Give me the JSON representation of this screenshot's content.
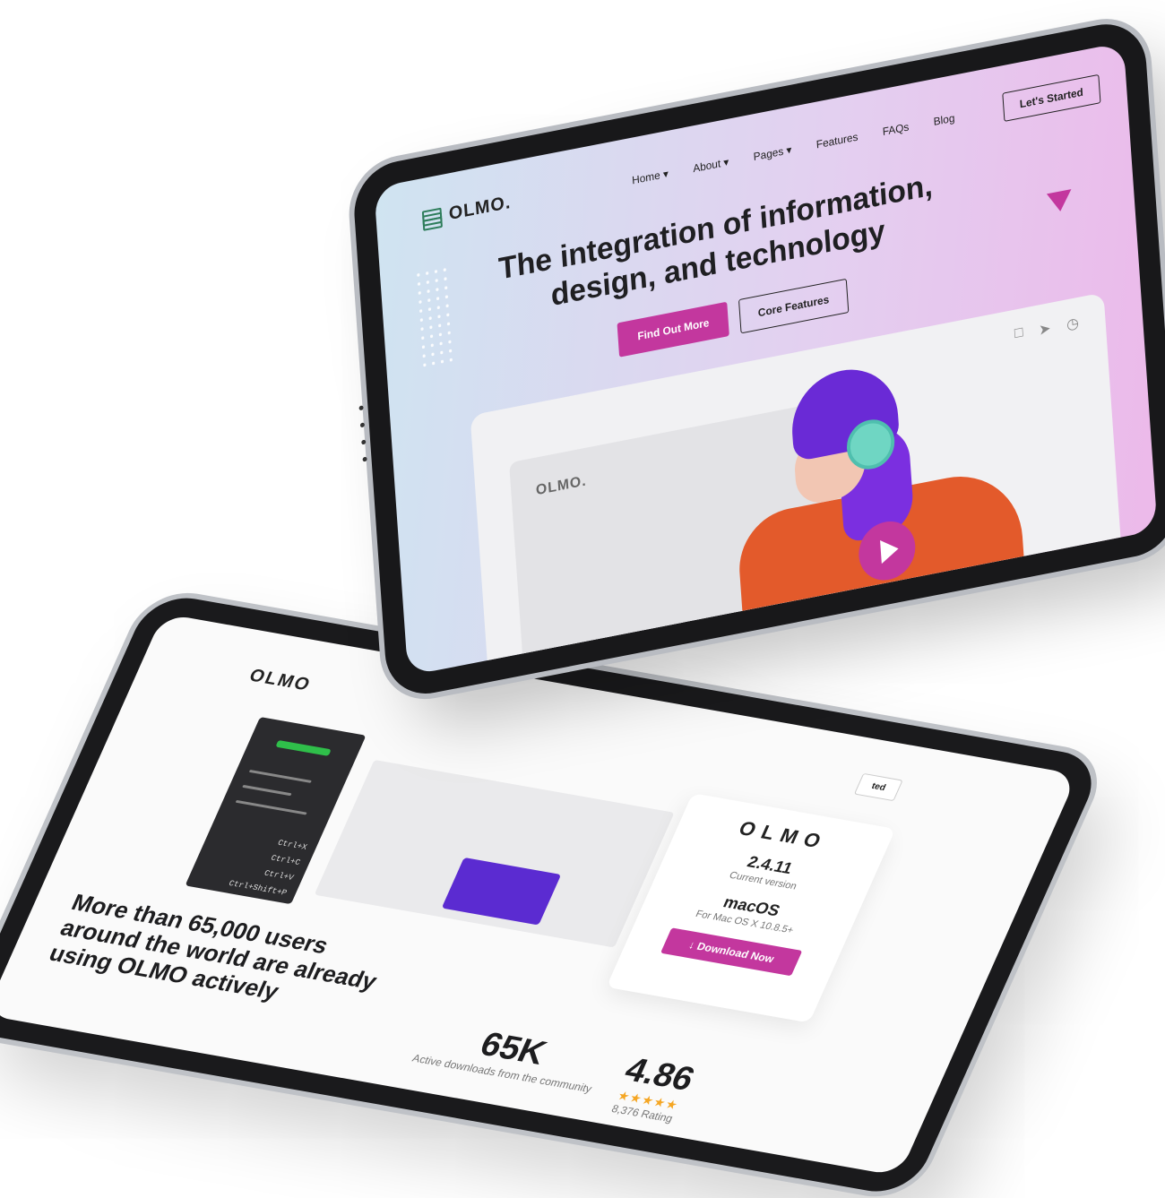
{
  "back_tablet": {
    "logo": "OLMO",
    "shortcuts": [
      "Ctrl+X",
      "Ctrl+C",
      "Ctrl+V",
      "Ctrl+Shift+P"
    ],
    "started_label": "ted",
    "card": {
      "title": "OLMO",
      "version": "2.4.11",
      "version_label": "Current version",
      "os": "macOS",
      "os_label": "For Mac OS X 10.8.5+",
      "download_button": "↓ Download Now"
    },
    "headline": "More than 65,000 users around the world are already using OLMO actively",
    "stats": [
      {
        "value": "65K",
        "label": "Active downloads from the community"
      },
      {
        "value": "4.86",
        "label": "8,376 Rating",
        "stars": "★★★★★"
      }
    ]
  },
  "front_tablet": {
    "logo": "OLMO.",
    "nav": [
      "Home ▾",
      "About ▾",
      "Pages ▾",
      "Features",
      "FAQs",
      "Blog"
    ],
    "nav_cta": "Let's Started",
    "hero_title": "The integration of information, design, and technology",
    "primary_button": "Find Out More",
    "secondary_button": "Core Features",
    "inner_logo": "OLMO.",
    "media_icons": [
      "bookmark-icon",
      "send-icon",
      "clock-icon"
    ],
    "accent_color": "#c3379e"
  }
}
